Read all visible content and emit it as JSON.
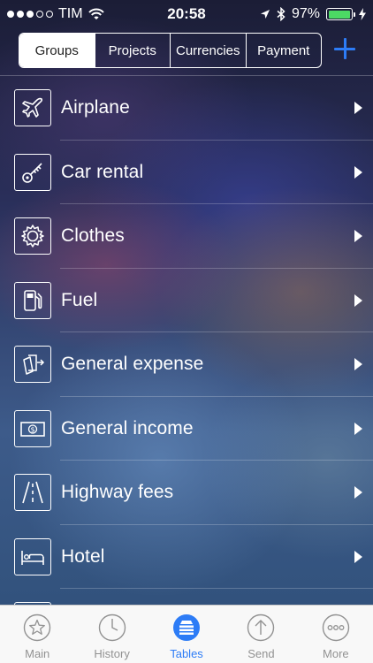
{
  "status_bar": {
    "carrier": "TIM",
    "time": "20:58",
    "battery_percent": "97%",
    "signal_bars_filled": 3,
    "signal_bars_total": 5,
    "battery_level": 0.97,
    "battery_color": "#4cd964"
  },
  "segments": [
    {
      "label": "Groups",
      "active": true
    },
    {
      "label": "Projects",
      "active": false
    },
    {
      "label": "Currencies",
      "active": false
    },
    {
      "label": "Payment",
      "active": false
    }
  ],
  "add_icon": "plus-icon",
  "accent_color": "#2d7cf6",
  "groups": [
    {
      "label": "Airplane",
      "icon": "airplane-icon"
    },
    {
      "label": "Car rental",
      "icon": "key-icon"
    },
    {
      "label": "Clothes",
      "icon": "gear-icon"
    },
    {
      "label": "Fuel",
      "icon": "fuel-pump-icon"
    },
    {
      "label": "General expense",
      "icon": "cards-exchange-icon"
    },
    {
      "label": "General income",
      "icon": "banknote-icon"
    },
    {
      "label": "Highway fees",
      "icon": "road-icon"
    },
    {
      "label": "Hotel",
      "icon": "bed-icon"
    }
  ],
  "tabs": [
    {
      "label": "Main",
      "icon": "star-icon",
      "active": false
    },
    {
      "label": "History",
      "icon": "clock-icon",
      "active": false
    },
    {
      "label": "Tables",
      "icon": "tables-icon",
      "active": true
    },
    {
      "label": "Send",
      "icon": "send-arrow-icon",
      "active": false
    },
    {
      "label": "More",
      "icon": "more-icon",
      "active": false
    }
  ]
}
